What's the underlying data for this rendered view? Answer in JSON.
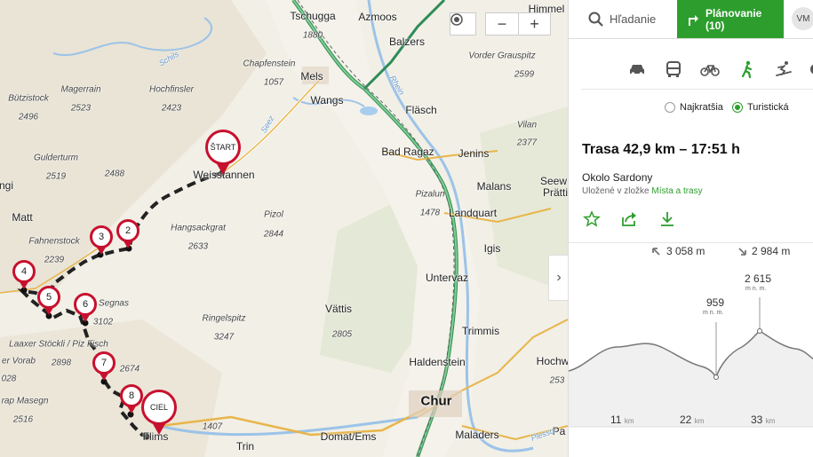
{
  "tabs": {
    "search_label": "Hľadanie",
    "plan_label": "Plánovanie (10)",
    "avatar_initials": "VM"
  },
  "modes": [
    "car-icon",
    "bus-icon",
    "bicycle-icon",
    "hiking-icon",
    "ski-icon",
    "more-icon"
  ],
  "route_options": {
    "shortest_label": "Najkratšia",
    "touristic_label": "Turistická",
    "selected": "touristic"
  },
  "route": {
    "title": "Trasa 42,9 km – 17:51 h",
    "name": "Okolo Sardony",
    "saved_prefix": "Uložené v zložke",
    "saved_link": "Místa a trasy"
  },
  "profile": {
    "ascent": "3 058 m",
    "descent": "2 984 m",
    "low_value": "959",
    "low_unit": "m n. m.",
    "high_value": "2 615",
    "high_unit": "m n. m.",
    "axis": [
      {
        "value": "11",
        "unit": "km"
      },
      {
        "value": "22",
        "unit": "km"
      },
      {
        "value": "33",
        "unit": "km"
      }
    ]
  },
  "map": {
    "zoom_in": "+",
    "zoom_out": "−",
    "pins": [
      "ŠTART",
      "2",
      "3",
      "4",
      "5",
      "6",
      "7",
      "8",
      "CIEL"
    ],
    "labels": {
      "tschugga": "Tschugga",
      "tschugga_e": "1880",
      "azmoos": "Azmoos",
      "himmel": "Himmel",
      "balzers": "Balzers",
      "vorder": "Vorder Grauspitz",
      "vorder_e": "2599",
      "chapfenstein": "Chapfenstein",
      "chapfenstein_e": "1057",
      "mels": "Mels",
      "wangs": "Wangs",
      "flasch": "Fläsch",
      "butzistock": "Bützistock",
      "butzistock_e": "2496",
      "magerrain": "Magerrain",
      "magerrain_e": "2523",
      "hochfinsler": "Hochfinsler",
      "hochfinsler_e": "2423",
      "vilan": "Vilan",
      "vilan_e": "2377",
      "gulderturm": "Gulderturm",
      "gulderturm_e": "2519",
      "e2488": "2488",
      "weisstannen": "Weisstannen",
      "badragaz": "Bad Ragaz",
      "jenins": "Jenins",
      "malans": "Malans",
      "seew": "Seew",
      "pratti": "Prätti",
      "matt": "Matt",
      "fahnenstock": "Fahnenstock",
      "fahnenstock_e": "2239",
      "hangsackgrat": "Hangsackgrat",
      "hangsackgrat_e": "2633",
      "pizol": "Pizol",
      "pizol_e": "2844",
      "pizalun": "Pizalun",
      "pizalun_e": "1478",
      "landquart": "Landquart",
      "igis": "Igis",
      "untervaz": "Untervaz",
      "segnas": "Segnas",
      "segnas_e": "3102",
      "vattis": "Vättis",
      "ringelspitz": "Ringelspitz",
      "ringelspitz_e": "3247",
      "e2805": "2805",
      "trimmis": "Trimmis",
      "laaxer": "Laaxer Stöckli / Piz Fisch",
      "e2898": "2898",
      "vorab": "er Vorab",
      "e028": "028",
      "e2674": "2674",
      "haldenstein": "Haldenstein",
      "hochw": "Hochw",
      "e253": "253",
      "chur": "Chur",
      "masegn": "rap Masegn",
      "e2516": "2516",
      "e1407": "1407",
      "domat": "Domat/Ems",
      "trin": "Trin",
      "maladers": "Maladers",
      "pa": "Pa",
      "flims": "Flims",
      "e2": "2",
      "ngi": "ngi",
      "river_rhein": "Rhein",
      "river_seez": "Seez",
      "river_schils": "Schils",
      "river_plessur": "Plessur"
    }
  }
}
